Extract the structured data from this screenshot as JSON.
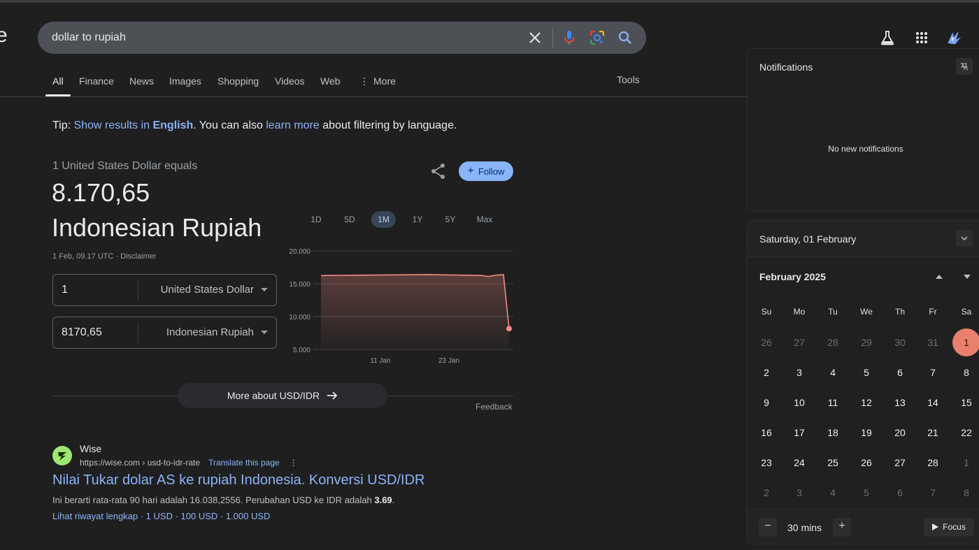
{
  "search": {
    "query": "dollar to rupiah"
  },
  "tabs": [
    "All",
    "Finance",
    "News",
    "Images",
    "Shopping",
    "Videos",
    "Web",
    "More"
  ],
  "tools_label": "Tools",
  "tip": {
    "prefix": "Tip: ",
    "show_results": "Show results in ",
    "language": "English",
    "mid": ". You can also ",
    "learn_more": "learn more",
    "suffix": " about filtering by language."
  },
  "converter": {
    "equals_label": "1 United States Dollar equals",
    "value": "8.170,65",
    "currency_name": "Indonesian Rupiah",
    "timestamp": "1 Feb, 09.17 UTC · Disclaimer",
    "from_amount": "1",
    "from_currency": "United States Dollar",
    "to_amount": "8170,65",
    "to_currency": "Indonesian Rupiah",
    "follow_label": "Follow",
    "ranges": [
      "1D",
      "5D",
      "1M",
      "1Y",
      "5Y",
      "Max"
    ],
    "active_range": "1M",
    "more_label": "More about USD/IDR",
    "feedback_label": "Feedback"
  },
  "chart_data": {
    "type": "area",
    "y_ticks": [
      "20.000",
      "15.000",
      "10.000",
      "5.000"
    ],
    "x_ticks": [
      "11 Jan",
      "23 Jan"
    ],
    "ylim": [
      5000,
      20000
    ],
    "values": [
      16250,
      16260,
      16270,
      16280,
      16290,
      16300,
      16300,
      16310,
      16320,
      16330,
      16340,
      16350,
      16350,
      16360,
      16380,
      16390,
      16400,
      16380,
      16350,
      16340,
      16330,
      16310,
      16290,
      16270,
      16260,
      16100,
      16300,
      16380,
      8170.65
    ],
    "line_color": "#f28b82"
  },
  "result": {
    "site_name": "Wise",
    "url": "https://wise.com › usd-to-idr-rate",
    "translate": "Translate this page",
    "title": "Nilai Tukar dolar AS ke rupiah Indonesia. Konversi USD/IDR",
    "snippet_prefix": "Ini berarti rata-rata 90 hari adalah 16.038,2556. Perubahan USD ke IDR adalah ",
    "snippet_bold": "3.69",
    "snippet_suffix": ".",
    "links": "Lihat riwayat lengkap · 1 USD · 100 USD · 1.000 USD"
  },
  "notifications": {
    "title": "Notifications",
    "empty": "No new notifications"
  },
  "calendar": {
    "date_title": "Saturday, 01 February",
    "month": "February 2025",
    "weekdays": [
      "Su",
      "Mo",
      "Tu",
      "We",
      "Th",
      "Fr",
      "Sa"
    ],
    "weeks": [
      [
        "26",
        "27",
        "28",
        "29",
        "30",
        "31",
        "1"
      ],
      [
        "2",
        "3",
        "4",
        "5",
        "6",
        "7",
        "8"
      ],
      [
        "9",
        "10",
        "11",
        "12",
        "13",
        "14",
        "15"
      ],
      [
        "16",
        "17",
        "18",
        "19",
        "20",
        "21",
        "22"
      ],
      [
        "23",
        "24",
        "25",
        "26",
        "27",
        "28",
        "1"
      ],
      [
        "2",
        "3",
        "4",
        "5",
        "6",
        "7",
        "8"
      ]
    ],
    "dim": [
      [
        0,
        0
      ],
      [
        0,
        1
      ],
      [
        0,
        2
      ],
      [
        0,
        3
      ],
      [
        0,
        4
      ],
      [
        0,
        5
      ],
      [
        4,
        6
      ],
      [
        5,
        0
      ],
      [
        5,
        1
      ],
      [
        5,
        2
      ],
      [
        5,
        3
      ],
      [
        5,
        4
      ],
      [
        5,
        5
      ],
      [
        5,
        6
      ]
    ],
    "today": [
      0,
      6
    ],
    "focus_duration": "30 mins",
    "focus_label": "Focus"
  }
}
